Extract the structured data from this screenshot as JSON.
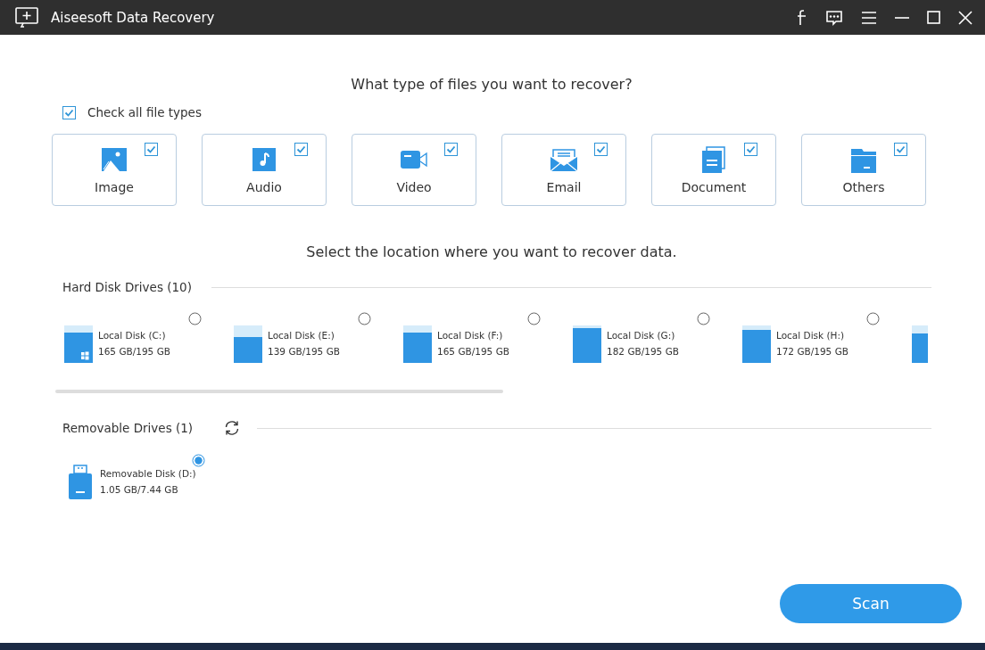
{
  "window": {
    "title": "Aiseesoft Data Recovery"
  },
  "file_types": {
    "heading": "What type of files you want to recover?",
    "check_all": {
      "label": "Check all file types",
      "checked": true
    },
    "items": [
      {
        "kind": "image",
        "label": "Image",
        "checked": true
      },
      {
        "kind": "audio",
        "label": "Audio",
        "checked": true
      },
      {
        "kind": "video",
        "label": "Video",
        "checked": true
      },
      {
        "kind": "email",
        "label": "Email",
        "checked": true
      },
      {
        "kind": "document",
        "label": "Document",
        "checked": true
      },
      {
        "kind": "others",
        "label": "Others",
        "checked": true
      }
    ]
  },
  "location": {
    "heading": "Select the location where you want to recover data.",
    "hard_disks": {
      "label": "Hard Disk Drives (10)",
      "items": [
        {
          "name": "Local Disk (C:)",
          "size": "165 GB/195 GB",
          "level": 0.82,
          "system": true,
          "selected": false
        },
        {
          "name": "Local Disk (E:)",
          "size": "139 GB/195 GB",
          "level": 0.7,
          "system": false,
          "selected": false
        },
        {
          "name": "Local Disk (F:)",
          "size": "165 GB/195 GB",
          "level": 0.82,
          "system": false,
          "selected": false
        },
        {
          "name": "Local Disk (G:)",
          "size": "182 GB/195 GB",
          "level": 0.92,
          "system": false,
          "selected": false
        },
        {
          "name": "Local Disk (H:)",
          "size": "172 GB/195 GB",
          "level": 0.88,
          "system": false,
          "selected": false
        }
      ],
      "partial_disk": {
        "level": 0.78
      }
    },
    "removable": {
      "label": "Removable Drives (1)",
      "items": [
        {
          "name": "Removable Disk (D:)",
          "size": "1.05 GB/7.44 GB",
          "selected": true
        }
      ]
    }
  },
  "scan_button": "Scan"
}
